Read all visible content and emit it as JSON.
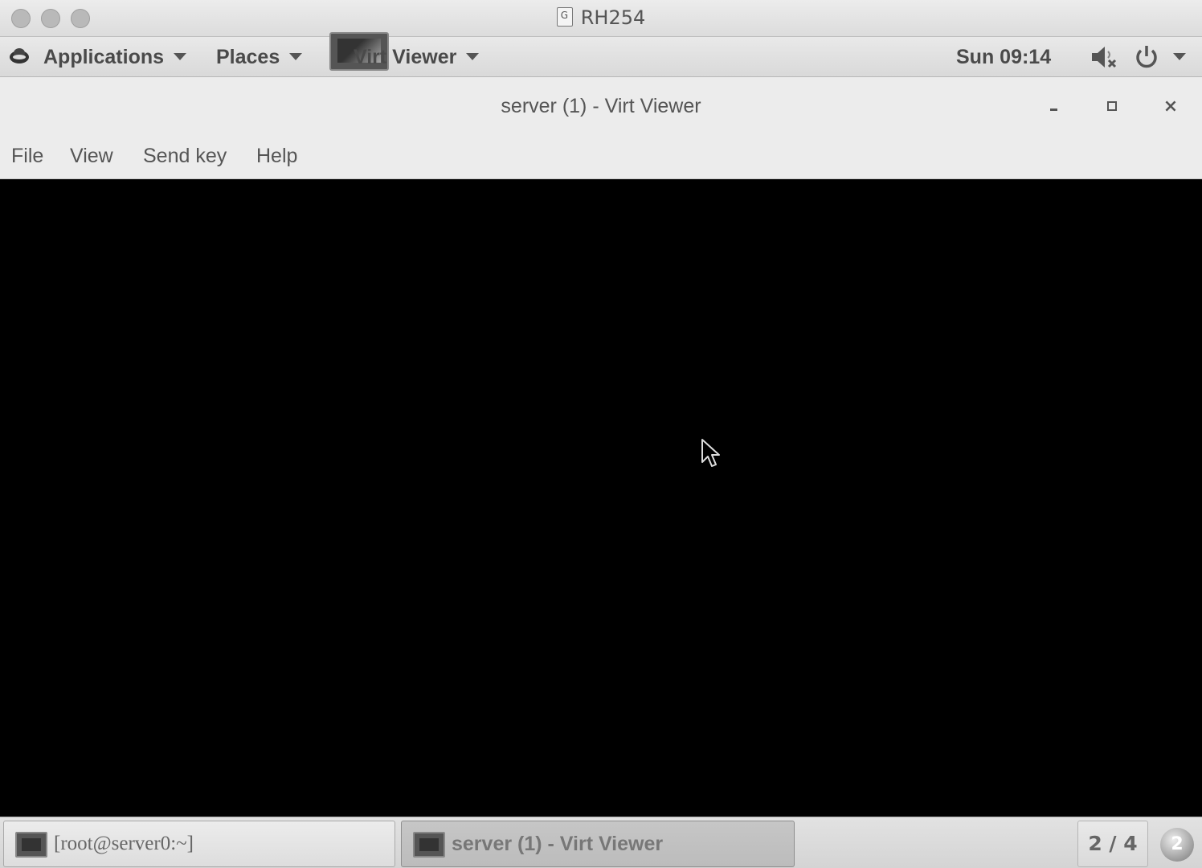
{
  "host_window": {
    "title": "RH254",
    "doc_icon": "document-icon"
  },
  "top_panel": {
    "applications_label": "Applications",
    "places_label": "Places",
    "active_app_label": "Virt Viewer",
    "clock": "Sun 09:14",
    "icons": [
      "redhat-logo-icon",
      "speaker-muted-icon",
      "power-icon",
      "chevron-down-icon"
    ]
  },
  "vv_window": {
    "title": "server (1) - Virt Viewer",
    "minimize_label": "_",
    "close_label": "×",
    "menu": {
      "file": "File",
      "view": "View",
      "send_key": "Send key",
      "help": "Help"
    }
  },
  "vm_display": {
    "background": "#000000"
  },
  "taskbar": {
    "items": [
      {
        "label": "[root@server0:~]",
        "icon": "terminal-icon"
      },
      {
        "label": "server (1) - Virt Viewer",
        "icon": "virt-viewer-icon"
      }
    ],
    "workspace": "2 / 4",
    "notification_count": "2"
  }
}
